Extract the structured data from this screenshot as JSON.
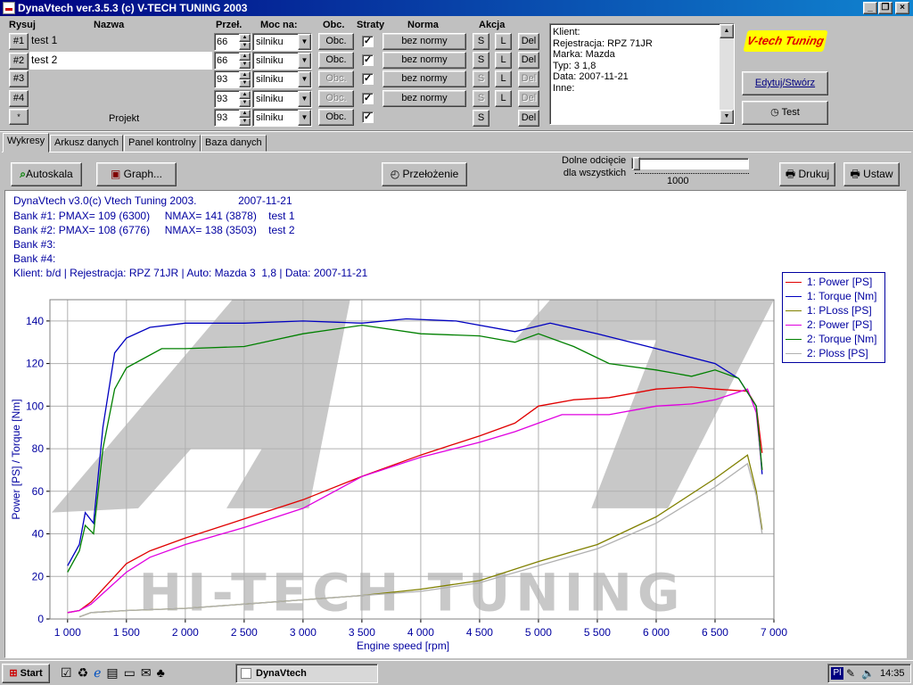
{
  "window": {
    "title": "DynaVtech ver.3.5.3 (c) V-TECH TUNING 2003"
  },
  "headers": {
    "rysuj": "Rysuj",
    "nazwa": "Nazwa",
    "przel": "Przeł.",
    "moc_na": "Moc na:",
    "obc": "Obc.",
    "straty": "Straty",
    "norma": "Norma",
    "akcja": "Akcja"
  },
  "rows": [
    {
      "btn": "#1",
      "name": "test 1",
      "przel": "66",
      "moc": "silniku",
      "obc": "Obc.",
      "norma": "bez normy"
    },
    {
      "btn": "#2",
      "name": "test 2",
      "przel": "66",
      "moc": "silniku",
      "obc": "Obc.",
      "norma": "bez normy"
    },
    {
      "btn": "#3",
      "name": "",
      "przel": "93",
      "moc": "silniku",
      "obc": "Obc.",
      "norma": "bez normy"
    },
    {
      "btn": "#4",
      "name": "",
      "przel": "93",
      "moc": "silniku",
      "obc": "Obc.",
      "norma": "bez normy"
    },
    {
      "btn": "*",
      "name": "Projekt",
      "przel": "93",
      "moc": "silniku",
      "obc": "Obc.",
      "norma": ""
    }
  ],
  "akcja": {
    "s": "S",
    "l": "L",
    "del": "Del"
  },
  "client_info": [
    "Klient:",
    "Rejestracja: RPZ 71JR",
    "Marka: Mazda",
    "Typ: 3  1,8",
    "Data: 2007-11-21",
    "Inne:"
  ],
  "logo": "V-tech Tuning",
  "buttons": {
    "edytuj": "Edytuj/Stwórz",
    "test": "Test",
    "autoskala": "Autoskala",
    "graph": "Graph...",
    "przelozenie": "Przełożenie",
    "drukuj": "Drukuj",
    "ustaw": "Ustaw"
  },
  "tabs": [
    "Wykresy",
    "Arkusz danych",
    "Panel kontrolny",
    "Baza danych"
  ],
  "cutoff": {
    "label1": "Dolne odcięcie",
    "label2": "dla wszystkich",
    "value": "1000"
  },
  "chart_header": [
    "DynaVtech v3.0(c) Vtech Tuning 2003.              2007-11-21",
    "Bank #1: PMAX= 109 (6300)     NMAX= 141 (3878)    test 1",
    "Bank #2: PMAX= 108 (6776)     NMAX= 138 (3503)    test 2",
    "Bank #3:",
    "Bank #4:",
    "Klient: b/d | Rejestracja: RPZ 71JR | Auto: Mazda 3  1,8 | Data: 2007-11-21"
  ],
  "watermark": {
    "big": "A7",
    "text": "HI-TECH TUNING"
  },
  "chart_data": {
    "type": "line",
    "xlabel": "Engine speed [rpm]",
    "ylabel": "Power [PS] / Torque [Nm]",
    "xlim": [
      850,
      7000
    ],
    "ylim": [
      0,
      150
    ],
    "xticks": [
      1000,
      1500,
      2000,
      2500,
      3000,
      3500,
      4000,
      4500,
      5000,
      5500,
      6000,
      6500,
      7000
    ],
    "xtick_labels": [
      "1 000",
      "1 500",
      "2 000",
      "2 500",
      "3 000",
      "3 500",
      "4 000",
      "4 500",
      "5 000",
      "5 500",
      "6 000",
      "6 500",
      "7 000"
    ],
    "yticks": [
      0,
      20,
      40,
      60,
      80,
      100,
      120,
      140
    ],
    "grid": true,
    "legend_position": "top-right",
    "series": [
      {
        "name": "1: Power [PS]",
        "color": "#e00000",
        "points": [
          [
            1000,
            3
          ],
          [
            1100,
            4
          ],
          [
            1200,
            8
          ],
          [
            1300,
            14
          ],
          [
            1500,
            26
          ],
          [
            1700,
            32
          ],
          [
            2000,
            38
          ],
          [
            2500,
            47
          ],
          [
            3000,
            56
          ],
          [
            3500,
            67
          ],
          [
            4000,
            77
          ],
          [
            4500,
            86
          ],
          [
            4800,
            92
          ],
          [
            5000,
            100
          ],
          [
            5300,
            103
          ],
          [
            5600,
            104
          ],
          [
            6000,
            108
          ],
          [
            6300,
            109
          ],
          [
            6500,
            108
          ],
          [
            6776,
            107
          ],
          [
            6850,
            100
          ],
          [
            6900,
            78
          ]
        ]
      },
      {
        "name": "1: Torque [Nm]",
        "color": "#0000c0",
        "points": [
          [
            1000,
            25
          ],
          [
            1100,
            35
          ],
          [
            1150,
            50
          ],
          [
            1220,
            45
          ],
          [
            1300,
            90
          ],
          [
            1400,
            125
          ],
          [
            1500,
            132
          ],
          [
            1700,
            137
          ],
          [
            2000,
            139
          ],
          [
            2500,
            139
          ],
          [
            3000,
            140
          ],
          [
            3500,
            139
          ],
          [
            3878,
            141
          ],
          [
            4300,
            140
          ],
          [
            4800,
            135
          ],
          [
            5100,
            139
          ],
          [
            5500,
            134
          ],
          [
            6000,
            127
          ],
          [
            6500,
            120
          ],
          [
            6700,
            113
          ],
          [
            6850,
            100
          ],
          [
            6900,
            68
          ]
        ]
      },
      {
        "name": "1: PLoss [PS]",
        "color": "#808000",
        "points": [
          [
            1100,
            1
          ],
          [
            1200,
            3
          ],
          [
            1500,
            4
          ],
          [
            2000,
            5
          ],
          [
            2500,
            7
          ],
          [
            3000,
            9
          ],
          [
            3500,
            11
          ],
          [
            4000,
            14
          ],
          [
            4500,
            18
          ],
          [
            5000,
            27
          ],
          [
            5500,
            35
          ],
          [
            6000,
            48
          ],
          [
            6500,
            66
          ],
          [
            6776,
            77
          ],
          [
            6850,
            60
          ],
          [
            6900,
            42
          ]
        ]
      },
      {
        "name": "2: Power [PS]",
        "color": "#e000e0",
        "points": [
          [
            1000,
            3
          ],
          [
            1100,
            4
          ],
          [
            1200,
            7
          ],
          [
            1300,
            12
          ],
          [
            1500,
            22
          ],
          [
            1700,
            29
          ],
          [
            2000,
            35
          ],
          [
            2500,
            43
          ],
          [
            3000,
            52
          ],
          [
            3503,
            67
          ],
          [
            4000,
            76
          ],
          [
            4500,
            83
          ],
          [
            4800,
            88
          ],
          [
            5000,
            92
          ],
          [
            5200,
            96
          ],
          [
            5600,
            96
          ],
          [
            6000,
            100
          ],
          [
            6300,
            101
          ],
          [
            6500,
            103
          ],
          [
            6776,
            108
          ],
          [
            6850,
            97
          ],
          [
            6900,
            70
          ]
        ]
      },
      {
        "name": "2: Torque [Nm]",
        "color": "#008000",
        "points": [
          [
            1000,
            22
          ],
          [
            1100,
            32
          ],
          [
            1150,
            44
          ],
          [
            1220,
            40
          ],
          [
            1300,
            80
          ],
          [
            1400,
            108
          ],
          [
            1500,
            118
          ],
          [
            1800,
            127
          ],
          [
            2000,
            127
          ],
          [
            2500,
            128
          ],
          [
            3000,
            134
          ],
          [
            3503,
            138
          ],
          [
            4000,
            134
          ],
          [
            4500,
            133
          ],
          [
            4800,
            130
          ],
          [
            5000,
            134
          ],
          [
            5300,
            128
          ],
          [
            5600,
            120
          ],
          [
            6000,
            117
          ],
          [
            6300,
            114
          ],
          [
            6500,
            117
          ],
          [
            6700,
            113
          ],
          [
            6850,
            100
          ],
          [
            6900,
            70
          ]
        ]
      },
      {
        "name": "2: Ploss [PS]",
        "color": "#b0b0b0",
        "points": [
          [
            1100,
            1
          ],
          [
            1200,
            3
          ],
          [
            1500,
            4
          ],
          [
            2000,
            5
          ],
          [
            2500,
            7
          ],
          [
            3000,
            9
          ],
          [
            3500,
            11
          ],
          [
            4000,
            13
          ],
          [
            4500,
            17
          ],
          [
            5000,
            25
          ],
          [
            5500,
            33
          ],
          [
            6000,
            45
          ],
          [
            6500,
            62
          ],
          [
            6776,
            73
          ],
          [
            6850,
            58
          ],
          [
            6900,
            40
          ]
        ]
      }
    ]
  },
  "taskbar": {
    "start": "Start",
    "task": "DynaVtech",
    "lang": "Pl",
    "clock": "14:35"
  }
}
